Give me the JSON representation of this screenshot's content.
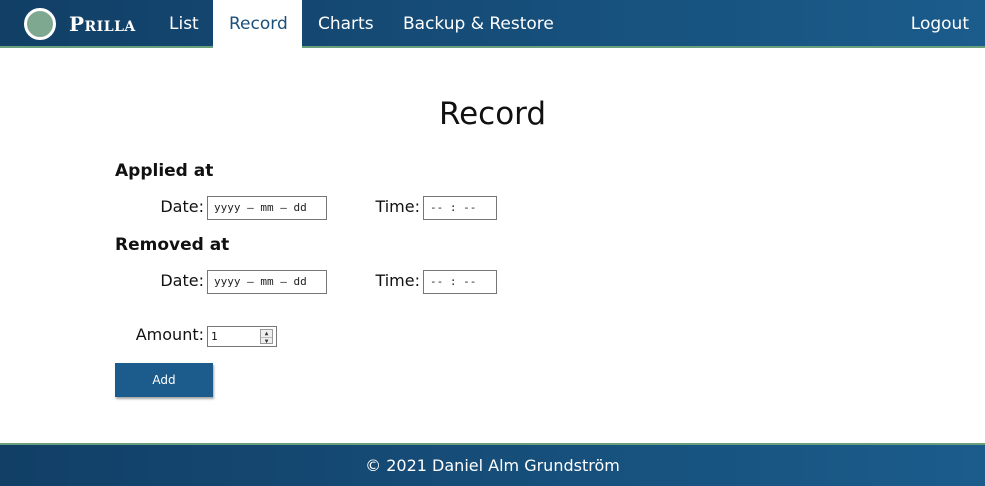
{
  "nav": {
    "brand": "Prilla",
    "items": [
      {
        "label": "List"
      },
      {
        "label": "Record"
      },
      {
        "label": "Charts"
      },
      {
        "label": "Backup & Restore"
      }
    ],
    "logout": "Logout",
    "active": "Record"
  },
  "page": {
    "title": "Record"
  },
  "applied": {
    "heading": "Applied at",
    "date_label": "Date:",
    "date_placeholder": "yyyy – mm – dd",
    "time_label": "Time:",
    "time_placeholder": "-- : --"
  },
  "removed": {
    "heading": "Removed at",
    "date_label": "Date:",
    "date_placeholder": "yyyy – mm – dd",
    "time_label": "Time:",
    "time_placeholder": "-- : --"
  },
  "amount": {
    "label": "Amount:",
    "value": "1"
  },
  "actions": {
    "add_label": "Add"
  },
  "footer": {
    "text": "© 2021 Daniel Alm Grundström"
  },
  "colors": {
    "nav_bg": "#1b5c8c",
    "accent_border": "#6a9f7e",
    "logo_fill": "#7fa890",
    "button_bg": "#1b5c8c"
  },
  "icons": {
    "logo": "circle-logo-icon",
    "spinner_up": "chevron-up-icon",
    "spinner_down": "chevron-down-icon"
  }
}
